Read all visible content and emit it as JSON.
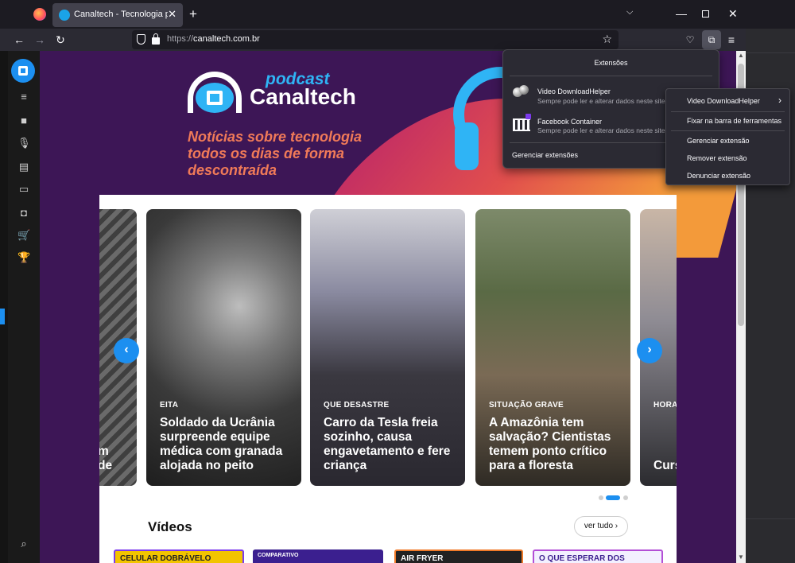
{
  "browser": {
    "tab_title": "Canaltech - Tecnologia para qu",
    "url_domain": "canaltech.com.br",
    "url_scheme": "https://"
  },
  "banner": {
    "podcast": "podcast",
    "brand": "Canaltech",
    "tagline_1": "Notícias sobre tecnologia",
    "tagline_2": "todos os dias de forma",
    "tagline_3": "descontraída"
  },
  "carousel": {
    "cards": [
      {
        "category": "",
        "headline": "m\nde"
      },
      {
        "category": "EITA",
        "headline": "Soldado da Ucrânia surpreende equipe médica com granada alojada no peito"
      },
      {
        "category": "QUE DESASTRE",
        "headline": "Carro da Tesla freia sozinho, causa engavetamento e fere criança"
      },
      {
        "category": "SITUAÇÃO GRAVE",
        "headline": "A Amazônia tem salvação? Cientistas temem ponto crítico para a floresta"
      },
      {
        "category": "HORA",
        "headline": "Curs tecn Lide mac mui"
      }
    ]
  },
  "videos": {
    "title": "Vídeos",
    "see_all": "ver tudo",
    "thumbs": [
      "CELULAR DOBRÁVELO",
      "COMPARATIVO",
      "AIR FRYER",
      "O QUE ESPERAR DOS"
    ]
  },
  "extensions": {
    "header": "Extensões",
    "items": [
      {
        "name": "Video DownloadHelper",
        "desc": "Sempre pode ler e alterar dados neste site"
      },
      {
        "name": "Facebook Container",
        "desc": "Sempre pode ler e alterar dados neste site"
      }
    ],
    "manage": "Gerenciar extensões"
  },
  "context_menu": {
    "title": "Video DownloadHelper",
    "pin": "Fixar na barra de ferramentas",
    "manage": "Gerenciar extensão",
    "remove": "Remover extensão",
    "report": "Denunciar extensão"
  },
  "colors": {
    "site_purple": "#3d1656",
    "accent_blue": "#1c8ff0",
    "tagline_orange": "#f07a58"
  }
}
